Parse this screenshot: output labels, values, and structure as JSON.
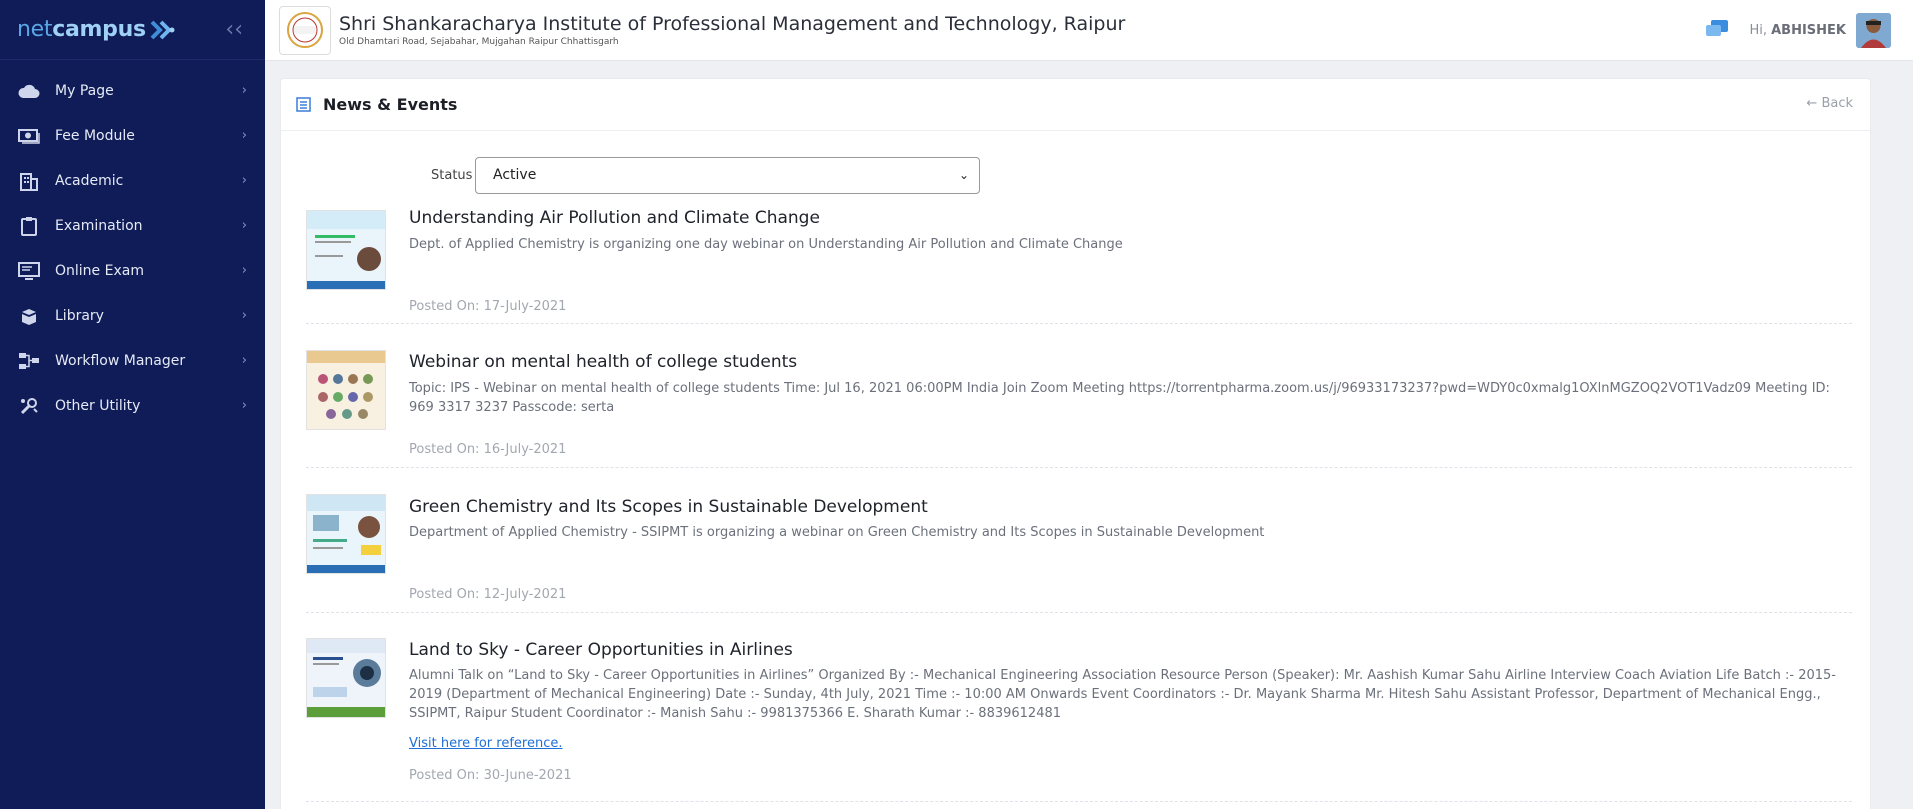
{
  "brand": {
    "part1": "net",
    "part2": "campus"
  },
  "sidebar": {
    "items": [
      {
        "label": "My Page",
        "icon": "cloud-icon"
      },
      {
        "label": "Fee Module",
        "icon": "cash-icon"
      },
      {
        "label": "Academic",
        "icon": "building-icon"
      },
      {
        "label": "Examination",
        "icon": "clipboard-icon"
      },
      {
        "label": "Online Exam",
        "icon": "monitor-icon"
      },
      {
        "label": "Library",
        "icon": "book-stack-icon"
      },
      {
        "label": "Workflow Manager",
        "icon": "flow-icon"
      },
      {
        "label": "Other Utility",
        "icon": "tools-icon"
      }
    ]
  },
  "header": {
    "institute_name": "Shri Shankaracharya Institute of Professional Management and Technology, Raipur",
    "address": "Old Dhamtari Road, Sejabahar, Mujgahan Raipur Chhattisgarh",
    "greeting": "Hi,",
    "user": "ABHISHEK"
  },
  "page": {
    "title": "News & Events",
    "back_label": "Back",
    "status_label": "Status",
    "status_value": "Active"
  },
  "news": [
    {
      "title": "Understanding Air Pollution and Climate Change",
      "description": "Dept. of Applied Chemistry is organizing one day webinar on Understanding Air Pollution and Climate Change",
      "posted": "Posted On: 17-July-2021"
    },
    {
      "title": "Webinar on mental health of college students",
      "description": "Topic: IPS - Webinar on mental health of college students Time: Jul 16, 2021 06:00PM India Join Zoom Meeting https://torrentpharma.zoom.us/j/96933173237?pwd=WDY0c0xmalg1OXlnMGZOQ2VOT1Vadz09 Meeting ID: 969 3317 3237 Passcode: serta",
      "posted": "Posted On: 16-July-2021"
    },
    {
      "title": "Green Chemistry and Its Scopes in Sustainable Development",
      "description": "Department of Applied Chemistry - SSIPMT is organizing a webinar on Green Chemistry and Its Scopes in Sustainable Development",
      "posted": "Posted On: 12-July-2021"
    },
    {
      "title": "Land to Sky - Career Opportunities in Airlines",
      "description": "Alumni Talk on “Land to Sky - Career Opportunities in Airlines” Organized By :- Mechanical Engineering Association Resource Person (Speaker): Mr. Aashish Kumar Sahu Airline Interview Coach Aviation Life Batch :- 2015-2019 (Department of Mechanical Engineering) Date :- Sunday, 4th July, 2021 Time :- 10:00 AM Onwards Event Coordinators :- Dr. Mayank Sharma Mr. Hitesh Sahu Assistant Professor, Department of Mechanical Engg., SSIPMT, Raipur Student Coordinator :- Manish Sahu :- 9981375366 E. Sharath Kumar :- 8839612481",
      "link": "Visit here for reference.",
      "posted": "Posted On: 30-June-2021"
    }
  ]
}
